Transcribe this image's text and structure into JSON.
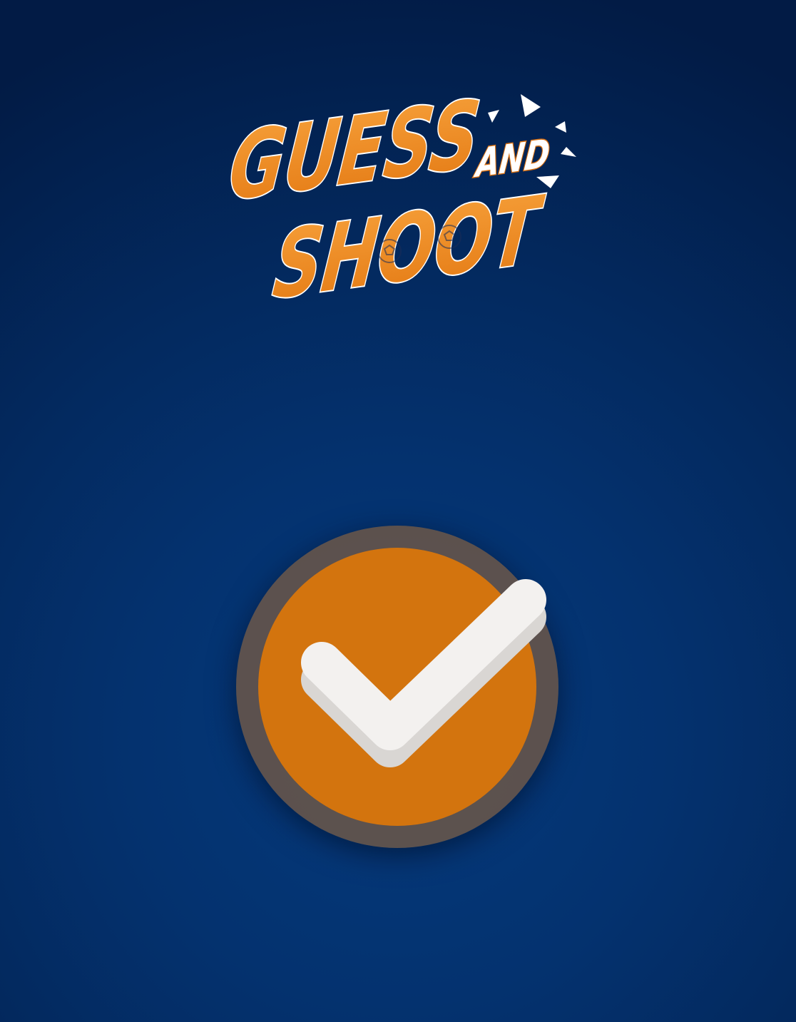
{
  "logo": {
    "line1": "GUESS",
    "connector": "AND",
    "line2": "SHOOT"
  },
  "confirm_button": {
    "icon": "check-icon",
    "state": "selected"
  },
  "colors": {
    "background_top": "#021b45",
    "background_center": "#053a7c",
    "logo_orange": "#ef8a1e",
    "button_orange": "#d3740e",
    "button_ring": "#705846",
    "check_white": "#f3f1ef"
  }
}
